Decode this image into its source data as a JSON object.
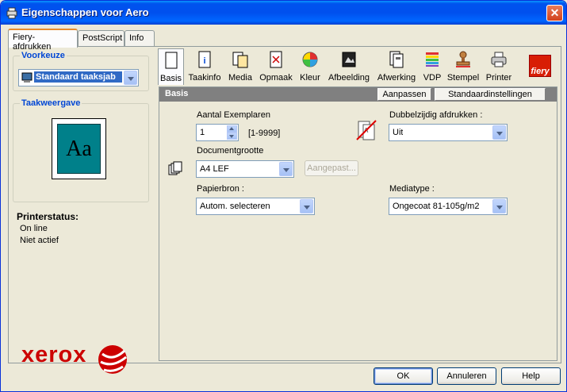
{
  "window": {
    "title": "Eigenschappen voor Aero",
    "close_label": "✕"
  },
  "tabs": [
    {
      "label": "Fiery-afdrukken",
      "active": true
    },
    {
      "label": "PostScript",
      "active": false
    },
    {
      "label": "Info",
      "active": false
    }
  ],
  "left": {
    "presets_title": "Voorkeuze",
    "presets_value": "Standaard taaksjab",
    "preview_title": "Taakweergave",
    "preview_text": "Aa",
    "printer_status_title": "Printerstatus:",
    "printer_status_lines": [
      "On line",
      "Niet actief"
    ],
    "logo_text": "xerox",
    "brand_color": "#cc0000"
  },
  "toolbar": {
    "items": [
      {
        "label": "Basis",
        "icon": "page-icon",
        "active": true
      },
      {
        "label": "Taakinfo",
        "icon": "info-icon"
      },
      {
        "label": "Media",
        "icon": "media-icon"
      },
      {
        "label": "Opmaak",
        "icon": "layout-icon"
      },
      {
        "label": "Kleur",
        "icon": "color-icon"
      },
      {
        "label": "Afbeelding",
        "icon": "image-icon"
      },
      {
        "label": "Afwerking",
        "icon": "finishing-icon"
      },
      {
        "label": "VDP",
        "icon": "vdp-icon"
      },
      {
        "label": "Stempel",
        "icon": "stamp-icon"
      },
      {
        "label": "Printer",
        "icon": "printer-icon"
      }
    ],
    "fiery_logo": "fiery"
  },
  "panel": {
    "title": "Basis",
    "customize_button": "Aanpassen",
    "defaults_button": "Standaardinstellingen",
    "copies_label": "Aantal Exemplaren",
    "copies_value": "1",
    "copies_range": "[1-9999]",
    "duplex_label": "Dubbelzijdig afdrukken :",
    "duplex_value": "Uit",
    "docsize_label": "Documentgrootte",
    "docsize_value": "A4 LEF",
    "custom_button": "Aangepast...",
    "source_label": "Papierbron :",
    "source_value": "Autom. selecteren",
    "mediatype_label": "Mediatype :",
    "mediatype_value": "Ongecoat 81-105g/m2"
  },
  "buttons": {
    "ok": "OK",
    "cancel": "Annuleren",
    "help": "Help"
  }
}
